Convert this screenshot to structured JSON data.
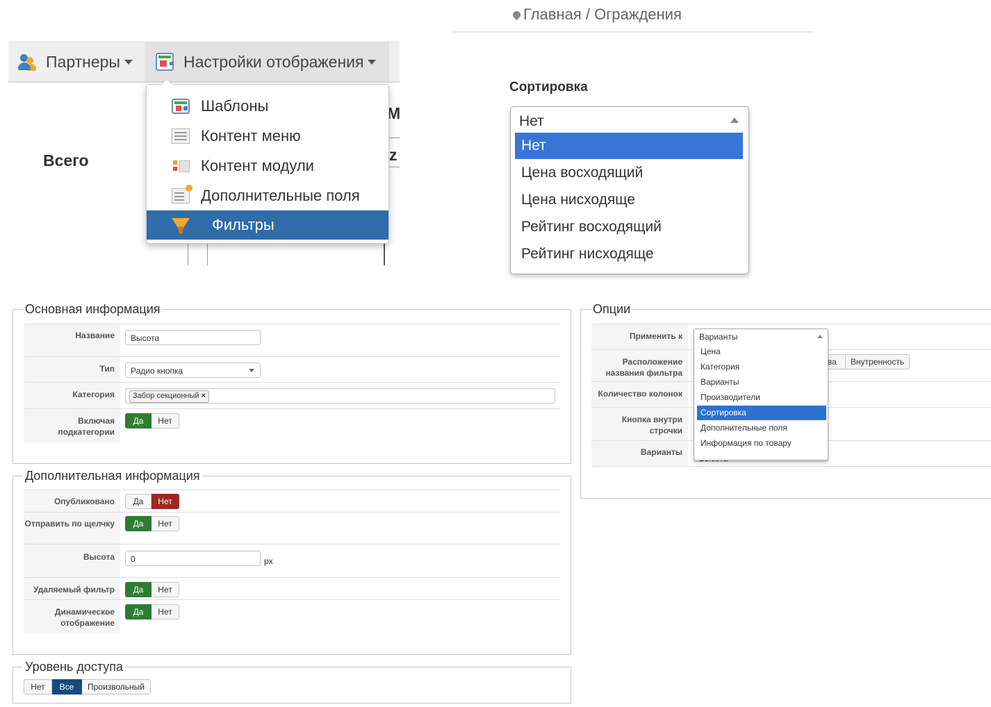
{
  "nav": {
    "partners": "Партнеры",
    "display_settings": "Настройки отображения",
    "total": "Всего",
    "cut_chars": [
      "М",
      "z"
    ],
    "dropdown": [
      {
        "label": "Шаблоны",
        "icon": "templates-icon"
      },
      {
        "label": "Контент меню",
        "icon": "menu-content-icon"
      },
      {
        "label": "Контент модули",
        "icon": "module-content-icon"
      },
      {
        "label": "Дополнительные поля",
        "icon": "extra-fields-icon"
      },
      {
        "label": "Фильтры",
        "icon": "filters-icon",
        "active": true
      }
    ]
  },
  "breadcrumb": {
    "home": "Главная",
    "separator": "/",
    "current": "Ограждения"
  },
  "sorting": {
    "label": "Сортировка",
    "selected": "Нет",
    "options": [
      "Нет",
      "Цена восходящий",
      "Цена нисходяще",
      "Рейтинг восходящий",
      "Рейтинг нисходяще"
    ]
  },
  "basic": {
    "legend": "Основная информация",
    "name_label": "Название",
    "name_value": "Высота",
    "type_label": "Тип",
    "type_value": "Радио кнопка",
    "category_label": "Категория",
    "category_tag": "Забор секционный",
    "tag_remove": "×",
    "include_sub_label": "Включая подкатегории",
    "yes": "Да",
    "no": "Нет"
  },
  "additional": {
    "legend": "Дополнительная информация",
    "published_label": "Опубликовано",
    "submit_click_label": "Отправить по щелчку",
    "height_label": "Высота",
    "height_value": "0",
    "height_unit": "px",
    "removable_label": "Удаляемый фильтр",
    "dynamic_label": "Динамическое отображение",
    "yes": "Да",
    "no": "Нет"
  },
  "access": {
    "legend": "Уровень доступа",
    "options": [
      "Нет",
      "Все",
      "Произвольный"
    ],
    "selected": "Все"
  },
  "options": {
    "legend": "Опции",
    "apply_label": "Применить к",
    "apply_value": "Варианты",
    "position_label": "Расположение названия фильтра",
    "pos_partial": "ава",
    "pos_inside": "Внутренность",
    "columns_label": "Количество колонок",
    "inline_button_label": "Кнопка внутри строчки",
    "variants_label": "Варианты",
    "variants_value": "Высота",
    "list": [
      "Цена",
      "Категория",
      "Варианты",
      "Производители",
      "Сортировка",
      "Дополнительные поля",
      "Информация по товару"
    ],
    "list_selected": "Сортировка"
  },
  "colors": {
    "yes_active": "#2e7d32",
    "no_active": "#a02722",
    "all_active": "#164a80",
    "menu_active": "#2f6ca8",
    "select_highlight": "#3875d7"
  }
}
